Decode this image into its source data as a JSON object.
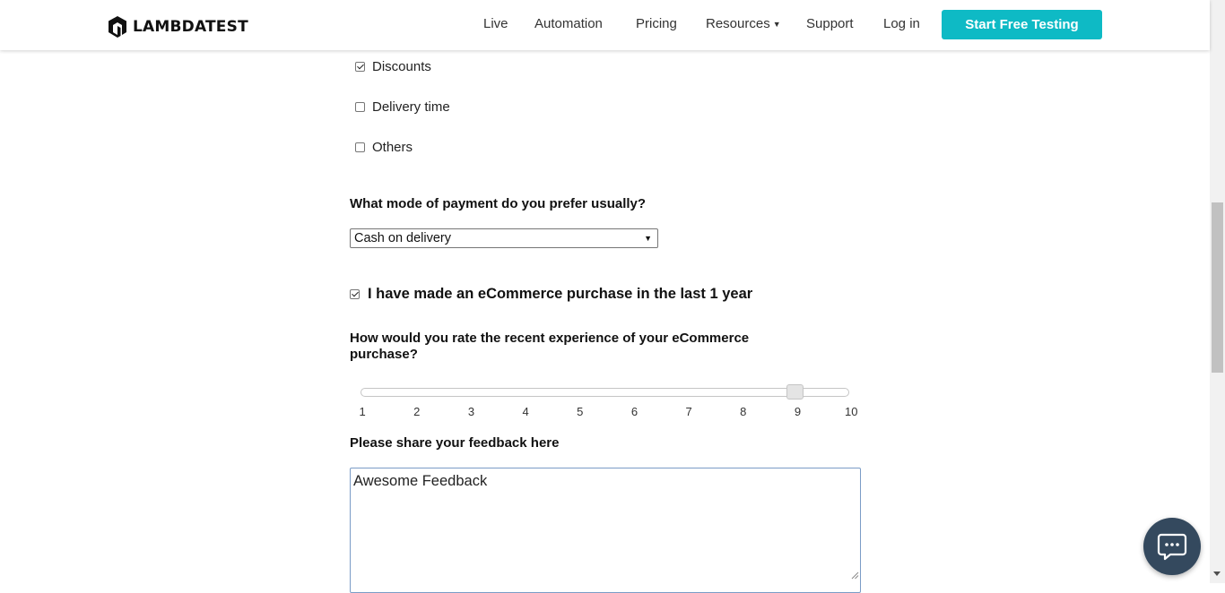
{
  "header": {
    "logo_text": "LAMBDATEST",
    "nav": [
      "Live",
      "Automation",
      "Pricing",
      "Resources",
      "Support",
      "Log in"
    ],
    "cta_label": "Start Free Testing"
  },
  "factors": [
    {
      "label": "Discounts",
      "checked": true
    },
    {
      "label": "Delivery time",
      "checked": false
    },
    {
      "label": "Others",
      "checked": false
    }
  ],
  "payment": {
    "question": "What mode of payment do you prefer usually?",
    "selected": "Cash on delivery"
  },
  "purchase": {
    "label": "I have made an eCommerce purchase in the last 1 year",
    "checked": true
  },
  "rating": {
    "question": "How would you rate the recent experience of your eCommerce purchase?",
    "ticks": [
      "1",
      "2",
      "3",
      "4",
      "5",
      "6",
      "7",
      "8",
      "9",
      "10"
    ],
    "value": 9
  },
  "feedback": {
    "question": "Please share your feedback here",
    "value": "Awesome Feedback"
  },
  "colors": {
    "cta": "#0ebac5",
    "chat": "#34495e"
  },
  "icons": {
    "chat": "chat-bubble-icon",
    "resources_chevron": "chevron-down-icon"
  }
}
